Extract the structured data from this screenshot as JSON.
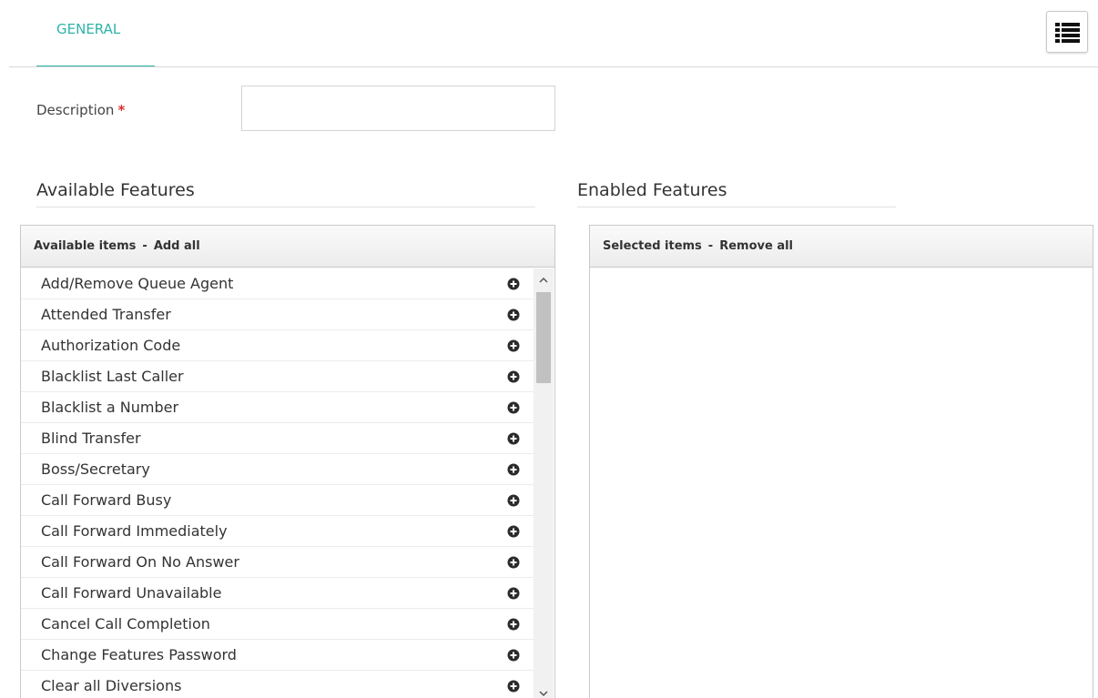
{
  "tabs": [
    {
      "label": "GENERAL",
      "active": true
    }
  ],
  "menu_button": {
    "icon": "list-icon"
  },
  "description": {
    "label": "Description",
    "required_mark": "*",
    "value": "",
    "placeholder": ""
  },
  "available": {
    "title": "Available Features",
    "header_label": "Available items",
    "separator": "-",
    "action": "Add all",
    "items": [
      "Add/Remove Queue Agent",
      "Attended Transfer",
      "Authorization Code",
      "Blacklist Last Caller",
      "Blacklist a Number",
      "Blind Transfer",
      "Boss/Secretary",
      "Call Forward Busy",
      "Call Forward Immediately",
      "Call Forward On No Answer",
      "Call Forward Unavailable",
      "Cancel Call Completion",
      "Change Features Password",
      "Clear all Diversions"
    ]
  },
  "enabled": {
    "title": "Enabled Features",
    "header_label": "Selected items",
    "separator": "-",
    "action": "Remove all",
    "items": []
  },
  "colors": {
    "accent": "#2fb3a8",
    "required": "#d9302f"
  }
}
